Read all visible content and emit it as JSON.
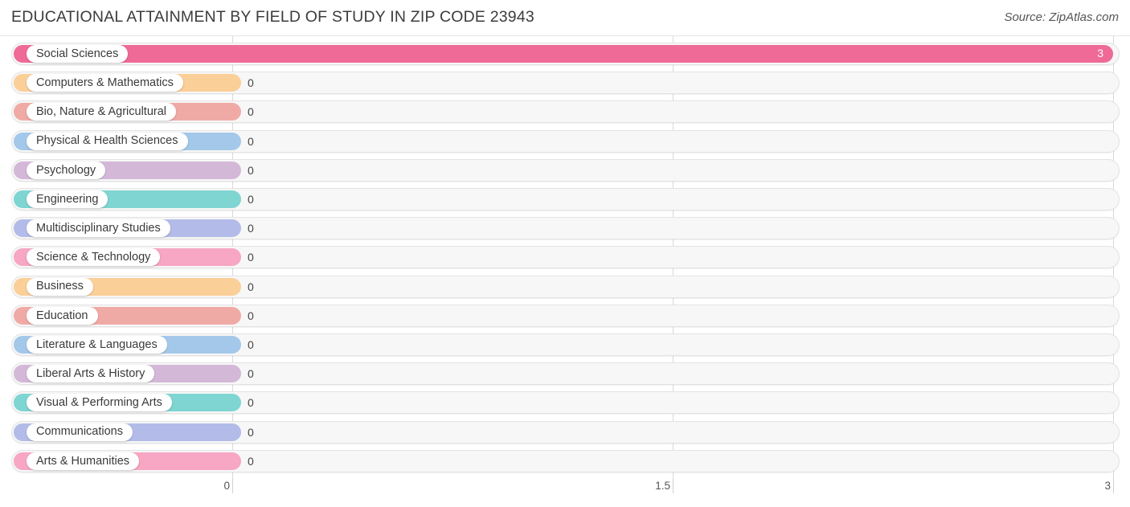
{
  "header": {
    "title": "EDUCATIONAL ATTAINMENT BY FIELD OF STUDY IN ZIP CODE 23943",
    "source": "Source: ZipAtlas.com"
  },
  "chart_data": {
    "type": "bar",
    "orientation": "horizontal",
    "title": "EDUCATIONAL ATTAINMENT BY FIELD OF STUDY IN ZIP CODE 23943",
    "xlabel": "",
    "ylabel": "",
    "xlim": [
      0,
      3
    ],
    "xticks": [
      "0",
      "1.5",
      "3"
    ],
    "xtick_values": [
      0,
      1.5,
      3
    ],
    "grid": true,
    "legend": "none",
    "categories": [
      "Social Sciences",
      "Computers & Mathematics",
      "Bio, Nature & Agricultural",
      "Physical & Health Sciences",
      "Psychology",
      "Engineering",
      "Multidisciplinary Studies",
      "Science & Technology",
      "Business",
      "Education",
      "Literature & Languages",
      "Liberal Arts & History",
      "Visual & Performing Arts",
      "Communications",
      "Arts & Humanities"
    ],
    "values": [
      3,
      0,
      0,
      0,
      0,
      0,
      0,
      0,
      0,
      0,
      0,
      0,
      0,
      0,
      0
    ],
    "value_labels": [
      "3",
      "0",
      "0",
      "0",
      "0",
      "0",
      "0",
      "0",
      "0",
      "0",
      "0",
      "0",
      "0",
      "0",
      "0"
    ],
    "colors": [
      "#ef6a97",
      "#fbcf98",
      "#f0aaa6",
      "#a3c8ea",
      "#d3b8d8",
      "#7fd5d2",
      "#b3bce8",
      "#f7a6c4",
      "#fbcf98",
      "#f0aaa6",
      "#a3c8ea",
      "#d3b8d8",
      "#7fd5d2",
      "#b3bce8",
      "#f7a6c4"
    ]
  }
}
